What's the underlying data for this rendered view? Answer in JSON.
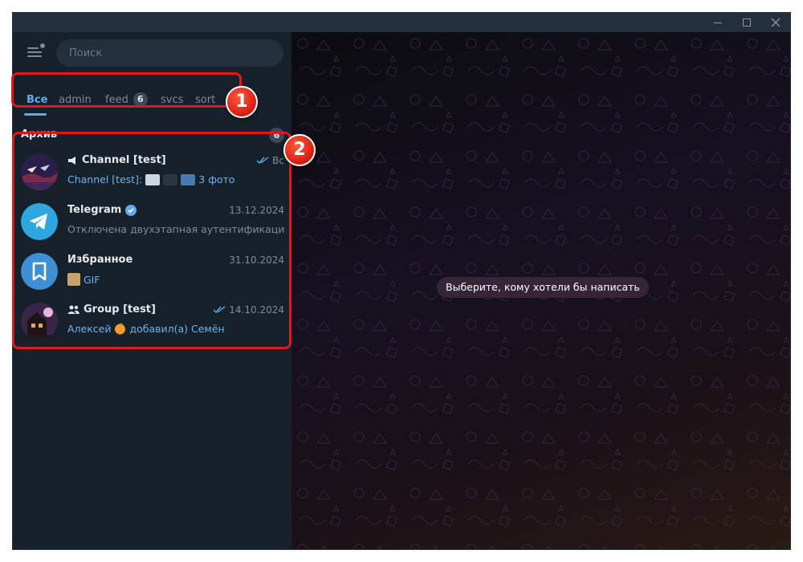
{
  "search": {
    "placeholder": "Поиск"
  },
  "tabs": [
    {
      "label": "Все",
      "active": true
    },
    {
      "label": "admin"
    },
    {
      "label": "feed",
      "badge": "6"
    },
    {
      "label": "svcs"
    },
    {
      "label": "sort"
    }
  ],
  "archive": {
    "label": "Архив",
    "count": "6"
  },
  "chats": [
    {
      "title": "Channel [test]",
      "date": "Вс",
      "read_checks": true,
      "preview_sender": "Channel [test]:",
      "preview_text": "3 фото",
      "type": "channel"
    },
    {
      "title": "Telegram",
      "verified": true,
      "date": "13.12.2024",
      "preview_text": "Отключена двухэтапная аутентификация!..."
    },
    {
      "title": "Избранное",
      "date": "31.10.2024",
      "preview_text": "GIF"
    },
    {
      "title": "Group [test]",
      "date": "14.10.2024",
      "read_checks": true,
      "preview_sender": "Алексей",
      "preview_text": "добавил(а) Семён",
      "type": "group"
    }
  ],
  "main": {
    "empty_message": "Выберите, кому хотели бы написать"
  },
  "callouts": [
    "1",
    "2"
  ],
  "colors": {
    "accent": "#5eabe8",
    "highlight": "#e0181c",
    "sidebar": "#17212b"
  }
}
